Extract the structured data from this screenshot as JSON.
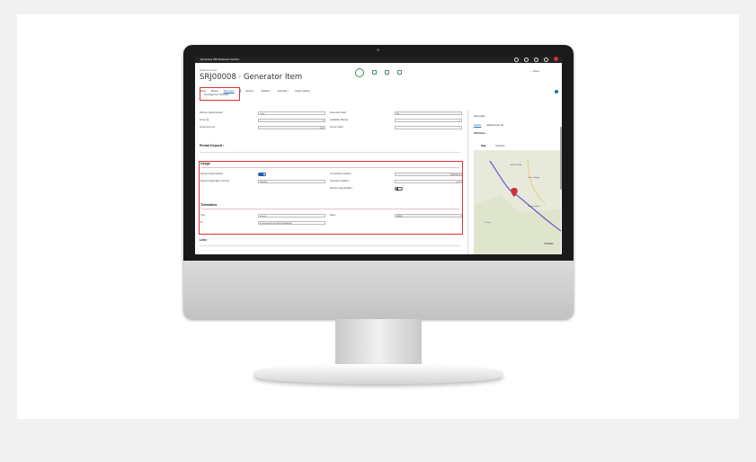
{
  "app": {
    "name": "Dynamics 365 Business Central"
  },
  "header": {
    "breadcrumb": "Rental Item Card",
    "title": "SRJ00008 · Generator Item",
    "saved": "✓ Saved"
  },
  "actions": {
    "home": "Home",
    "rental": "Rental",
    "telematics": "Telematics",
    "actions": "Actions ⌄",
    "related": "Related ⌄",
    "automate": "Automate ⌄",
    "fewer": "Fewer options",
    "sub_action": "Get Usage from Telematics"
  },
  "general": {
    "rows": [
      {
        "label": "Minimum Rental Duration",
        "value": "1 day"
      },
      {
        "label": "Group Qty",
        "value": "1"
      },
      {
        "label": "Group Gross Qty",
        "value": "0.00"
      }
    ],
    "right_rows": [
      {
        "label": "Reservation Start",
        "value": "No"
      },
      {
        "label": "Availability Warning",
        "value": "0"
      },
      {
        "label": "Service Status",
        "value": ""
      }
    ]
  },
  "rental_deposit": {
    "title": "Rental Deposit ›"
  },
  "usage": {
    "title": "Usage",
    "metered_enabled_label": "Metered Usage Enabled",
    "metered_base_label": "Metered Usage Base of M Cnts",
    "metered_base_value": "PIECES",
    "current_meter_label": "Current Meter Reading",
    "current_meter_value": "998,188.70",
    "time_meter_label": "Time Meter Reading",
    "time_meter_value": "0.00",
    "remote_label": "Remote Usage Enabled"
  },
  "telematics": {
    "title": "Telematics",
    "type_label": "Type",
    "type_value": "Vehicle",
    "id_label": "ID",
    "id_value": "67ca5a5b-4a1b-11ef-9405-00155d0e6d09",
    "name_label": "Name",
    "name_value": "GEN-8"
  },
  "link": {
    "title": "Link ›"
  },
  "factbox": {
    "summary": "Summary",
    "summary_badge": "Details",
    "details_tab": "Details",
    "attachments_tab": "Attachments (0)",
    "gps_title": "GPS Data ⌄",
    "map_tab": "Map",
    "satellite_tab": "Satellite",
    "places": [
      "CALIFORNIA",
      "Dunes Bridge",
      "Flowing Wells",
      "Tucson",
      "TUCSO"
    ]
  },
  "colors": {
    "highlight": "#e03030",
    "accent": "#0f6cbd",
    "toggle_on": "#1f5fa6",
    "route": "#6b57c9",
    "pin": "#d22e3c"
  }
}
